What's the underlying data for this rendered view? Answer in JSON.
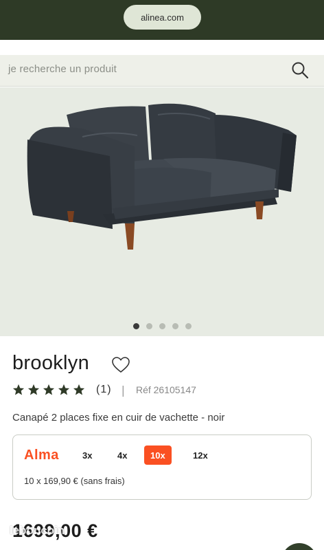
{
  "browser": {
    "url": "alinea.com"
  },
  "header": {
    "fragment": "..."
  },
  "search": {
    "placeholder": "je recherche un produit"
  },
  "gallery": {
    "total_images": 5,
    "active_index": 0
  },
  "product": {
    "title": "brooklyn",
    "rating_stars": 5,
    "rating_count": "(1)",
    "separator": "|",
    "reference": "Réf 26105147",
    "subtitle": "Canapé 2 places fixe en cuir de vachette - noir"
  },
  "payment": {
    "provider": "Alma",
    "options": [
      {
        "label": "3x",
        "selected": false
      },
      {
        "label": "4x",
        "selected": false
      },
      {
        "label": "10x",
        "selected": true
      },
      {
        "label": "12x",
        "selected": false
      }
    ],
    "detail": "10 x 169,90 € (sans frais)"
  },
  "price": "1699,00 €",
  "watermark": "leboncoin",
  "colors": {
    "topbar": "#2e3a26",
    "alma_orange": "#fa5022",
    "hero_bg": "#e7ebe3",
    "star": "#2f3a27"
  }
}
